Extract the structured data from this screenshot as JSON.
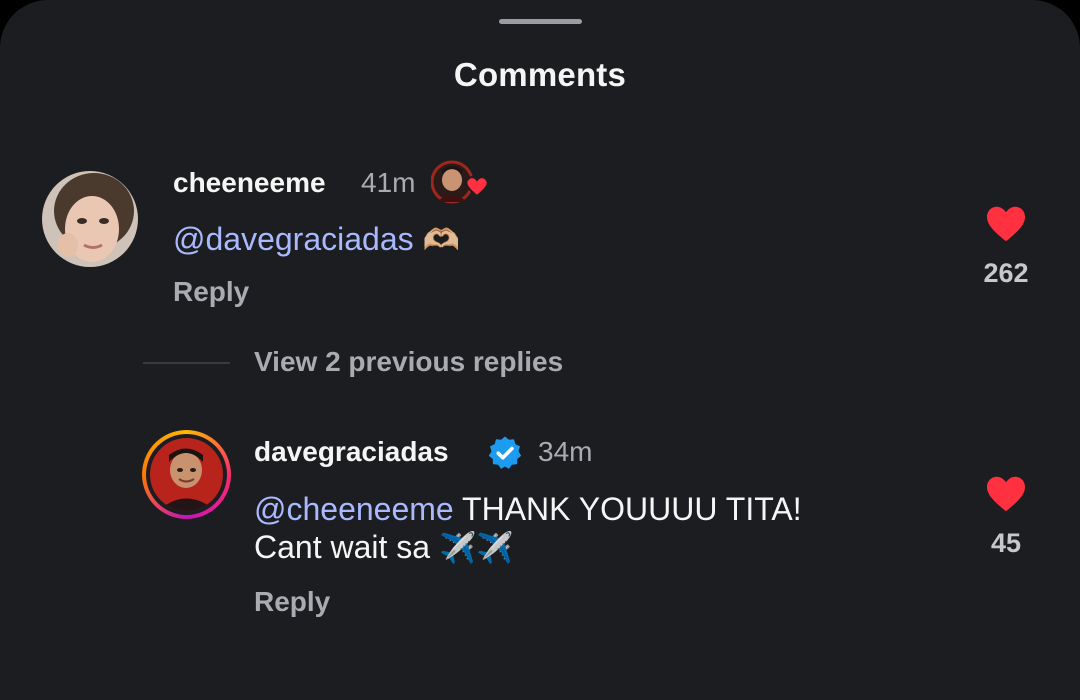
{
  "header": {
    "title": "Comments"
  },
  "comments": [
    {
      "username": "cheeneeme",
      "time": "41m",
      "mention": "@davegraciadas",
      "text": "",
      "emoji": "🫶🏼",
      "reply_label": "Reply",
      "likes": "262"
    },
    {
      "username": "davegraciadas",
      "verified": true,
      "time": "34m",
      "mention": "@cheeneeme",
      "text_line1": " THANK YOUUUU TITA!",
      "text_line2": "Cant wait sa ",
      "emoji": "✈️✈️",
      "reply_label": "Reply",
      "likes": "45"
    }
  ],
  "thread": {
    "view_replies_label": "View 2 previous replies"
  },
  "colors": {
    "background": "#1c1d20",
    "mention": "#a9b9ff",
    "like": "#ff3040",
    "verified": "#1d9bf0"
  }
}
